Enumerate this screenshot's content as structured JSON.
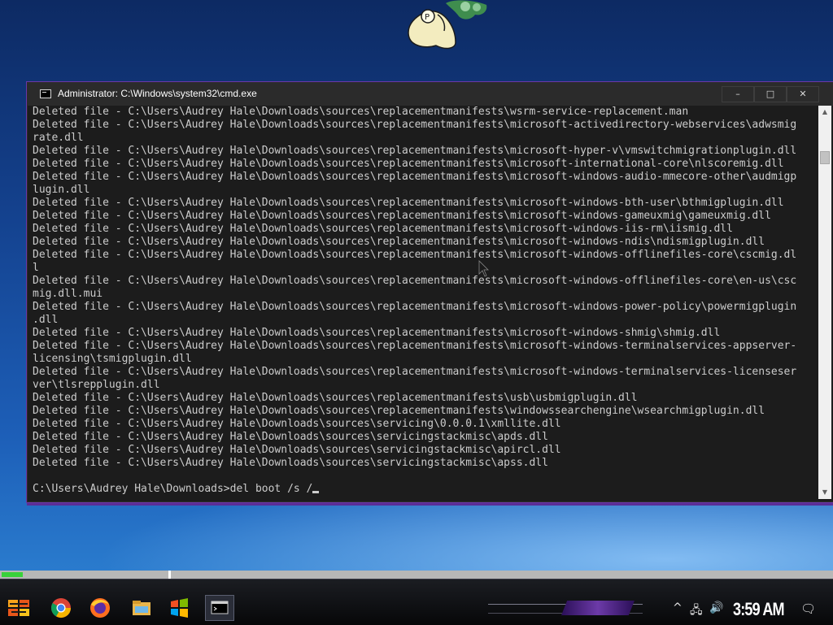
{
  "window": {
    "title": "Administrator: C:\\Windows\\system32\\cmd.exe",
    "buttons": {
      "minimize": "–",
      "maximize": "□",
      "close": "✕"
    }
  },
  "console": {
    "lines": [
      "Deleted file - C:\\Users\\Audrey Hale\\Downloads\\sources\\replacementmanifests\\wsrm-service-replacement.man",
      "Deleted file - C:\\Users\\Audrey Hale\\Downloads\\sources\\replacementmanifests\\microsoft-activedirectory-webservices\\adwsmig",
      "rate.dll",
      "Deleted file - C:\\Users\\Audrey Hale\\Downloads\\sources\\replacementmanifests\\microsoft-hyper-v\\vmswitchmigrationplugin.dll",
      "Deleted file - C:\\Users\\Audrey Hale\\Downloads\\sources\\replacementmanifests\\microsoft-international-core\\nlscoremig.dll",
      "Deleted file - C:\\Users\\Audrey Hale\\Downloads\\sources\\replacementmanifests\\microsoft-windows-audio-mmecore-other\\audmigp",
      "lugin.dll",
      "Deleted file - C:\\Users\\Audrey Hale\\Downloads\\sources\\replacementmanifests\\microsoft-windows-bth-user\\bthmigplugin.dll",
      "Deleted file - C:\\Users\\Audrey Hale\\Downloads\\sources\\replacementmanifests\\microsoft-windows-gameuxmig\\gameuxmig.dll",
      "Deleted file - C:\\Users\\Audrey Hale\\Downloads\\sources\\replacementmanifests\\microsoft-windows-iis-rm\\iismig.dll",
      "Deleted file - C:\\Users\\Audrey Hale\\Downloads\\sources\\replacementmanifests\\microsoft-windows-ndis\\ndismigplugin.dll",
      "Deleted file - C:\\Users\\Audrey Hale\\Downloads\\sources\\replacementmanifests\\microsoft-windows-offlinefiles-core\\cscmig.dl",
      "l",
      "Deleted file - C:\\Users\\Audrey Hale\\Downloads\\sources\\replacementmanifests\\microsoft-windows-offlinefiles-core\\en-us\\csc",
      "mig.dll.mui",
      "Deleted file - C:\\Users\\Audrey Hale\\Downloads\\sources\\replacementmanifests\\microsoft-windows-power-policy\\powermigplugin",
      ".dll",
      "Deleted file - C:\\Users\\Audrey Hale\\Downloads\\sources\\replacementmanifests\\microsoft-windows-shmig\\shmig.dll",
      "Deleted file - C:\\Users\\Audrey Hale\\Downloads\\sources\\replacementmanifests\\microsoft-windows-terminalservices-appserver-",
      "licensing\\tsmigplugin.dll",
      "Deleted file - C:\\Users\\Audrey Hale\\Downloads\\sources\\replacementmanifests\\microsoft-windows-terminalservices-licenseser",
      "ver\\tlsrepplugin.dll",
      "Deleted file - C:\\Users\\Audrey Hale\\Downloads\\sources\\replacementmanifests\\usb\\usbmigplugin.dll",
      "Deleted file - C:\\Users\\Audrey Hale\\Downloads\\sources\\replacementmanifests\\windowssearchengine\\wsearchmigplugin.dll",
      "Deleted file - C:\\Users\\Audrey Hale\\Downloads\\sources\\servicing\\0.0.0.1\\xmllite.dll",
      "Deleted file - C:\\Users\\Audrey Hale\\Downloads\\sources\\servicingstackmisc\\apds.dll",
      "Deleted file - C:\\Users\\Audrey Hale\\Downloads\\sources\\servicingstackmisc\\apircl.dll",
      "Deleted file - C:\\Users\\Audrey Hale\\Downloads\\sources\\servicingstackmisc\\apss.dll",
      ""
    ],
    "prompt": "C:\\Users\\Audrey Hale\\Downloads>",
    "command": "del boot /s /"
  },
  "progress": {
    "fraction": 0.025
  },
  "taskbar": {
    "apps": [
      {
        "name": "chrome-icon",
        "active": false
      },
      {
        "name": "firefox-icon",
        "active": false
      },
      {
        "name": "file-explorer-icon",
        "active": false
      },
      {
        "name": "windows-flag-icon",
        "active": false
      },
      {
        "name": "cmd-icon",
        "active": true
      }
    ],
    "clock": "3:59 AM",
    "tray": {
      "show_hidden": "^",
      "network": "🖧",
      "volume": "🔊",
      "notifications": "🗨"
    }
  }
}
